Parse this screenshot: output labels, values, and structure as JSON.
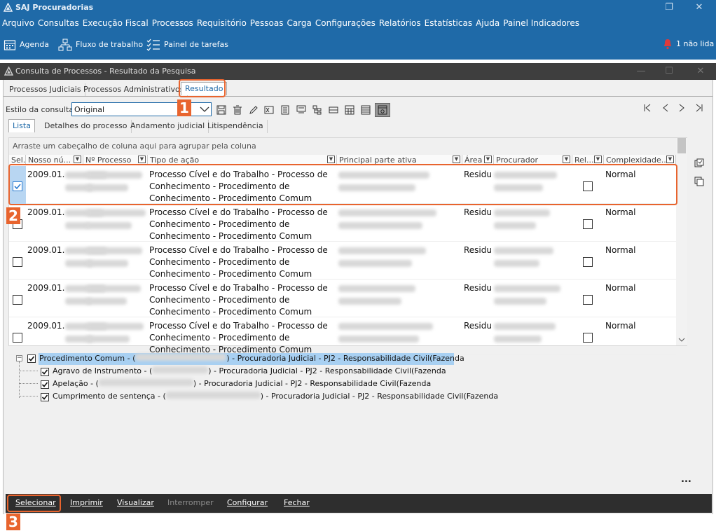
{
  "window": {
    "title": "SAJ Procuradorias"
  },
  "menu": [
    "Arquivo",
    "Consultas",
    "Execução Fiscal",
    "Processos",
    "Requisitório",
    "Pessoas",
    "Carga",
    "Configurações",
    "Relatórios",
    "Estatísticas",
    "Ajuda",
    "Painel Indicadores"
  ],
  "toolbar": {
    "agenda": "Agenda",
    "fluxo": "Fluxo de trabalho",
    "painel": "Painel de tarefas",
    "notif": "1 não lida"
  },
  "sub": {
    "title": "Consulta de Processos - Resultado da Pesquisa"
  },
  "tabs": [
    "Processos Judiciais",
    "Processos Administrativos",
    "Resultado"
  ],
  "estilo": {
    "label": "Estilo da consulta",
    "value": "Original"
  },
  "subtabs": [
    "Lista",
    "Detalhes do processo",
    "Andamento judicial",
    "Litispendência"
  ],
  "grid": {
    "groupbar": "Arraste um cabeçalho de coluna aqui para agrupar pela coluna",
    "columns": [
      "Sel.",
      "Nosso nú...",
      "Nº Processo",
      "Tipo de ação",
      "Principal parte ativa",
      "Área",
      "Procurador",
      "Rel...",
      "Complexidade..."
    ],
    "rows": [
      {
        "nosso": "2009.01.",
        "tipo1": "Processo Cível e do Trabalho - Processo de",
        "tipo2": "Conhecimento - Procedimento de",
        "tipo3": "Conhecimento - Procedimento Comum",
        "area": "Residu",
        "complex": "Normal"
      },
      {
        "nosso": "2009.01.",
        "tipo1": "Processo Cível e do Trabalho - Processo de",
        "tipo2": "Conhecimento - Procedimento de",
        "tipo3": "Conhecimento - Procedimento Comum",
        "area": "Residu",
        "complex": "Normal"
      },
      {
        "nosso": "2009.01.",
        "tipo1": "Processo Cível e do Trabalho - Processo de",
        "tipo2": "Conhecimento - Procedimento de",
        "tipo3": "Conhecimento - Procedimento Comum",
        "area": "Residu",
        "complex": "Normal"
      },
      {
        "nosso": "2009.01.",
        "tipo1": "Processo Cível e do Trabalho - Processo de",
        "tipo2": "Conhecimento - Procedimento de",
        "tipo3": "Conhecimento - Procedimento Comum",
        "area": "Residu",
        "complex": "Normal"
      },
      {
        "nosso": "2009.01.",
        "tipo1": "Processo Cível e do Trabalho - Processo de",
        "tipo2": "Conhecimento - Procedimento de",
        "tipo3": "Conhecimento - Procedimento Comum",
        "area": "Residu",
        "complex": "Normal"
      }
    ]
  },
  "tree": {
    "root": {
      "a": "Procedimento Comum - (",
      "b": ") - Procuradoria Judicial - PJ2 - Responsabilidade Civil(Fazenda"
    },
    "children": [
      {
        "a": "Agravo de Instrumento - (",
        "b": ") - Procuradoria Judicial - PJ2 - Responsabilidade Civil(Fazenda"
      },
      {
        "a": "Apelação - (",
        "b": ") - Procuradoria Judicial - PJ2 - Responsabilidade Civil(Fazenda"
      },
      {
        "a": "Cumprimento de sentença - (",
        "b": ") - Procuradoria Judicial - PJ2 - Responsabilidade Civil(Fazenda"
      }
    ]
  },
  "more": "...",
  "bottom": {
    "selecionar": "Selecionar",
    "imprimir": "Imprimir",
    "visualizar": "Visualizar",
    "interromper": "Interromper",
    "configurar": "Configurar",
    "fechar": "Fechar"
  },
  "badges": [
    "1",
    "2",
    "3"
  ],
  "colors": {
    "accent": "#1f6aa8",
    "callout": "#e8642e",
    "selectedRow": "#b8d6f2"
  }
}
